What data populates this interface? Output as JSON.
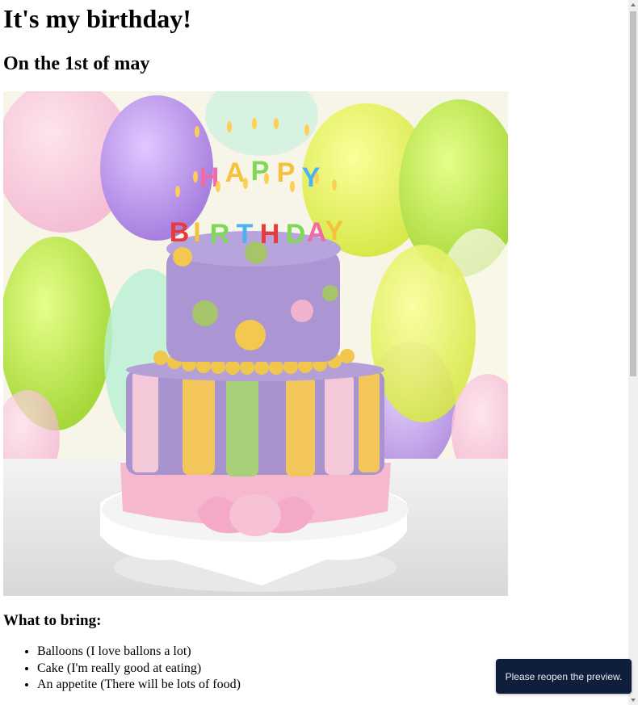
{
  "page": {
    "title": "It's my birthday!",
    "subtitle": "On the 1st of may",
    "image": {
      "cake_candle_text": "HAPPY BIRTHDAY"
    },
    "bring_heading": "What to bring:",
    "bring_items": [
      "Balloons (I love ballons a lot)",
      "Cake (I'm really good at eating)",
      "An appetite (There will be lots of food)"
    ]
  },
  "toast": {
    "message": "Please reopen the preview."
  },
  "colors": {
    "toast_bg": "#0f1e3a",
    "scrollbar_thumb": "#c1c1c1",
    "cake_purple": "#a993cf",
    "ribbon_pink": "#f6b8cf"
  }
}
